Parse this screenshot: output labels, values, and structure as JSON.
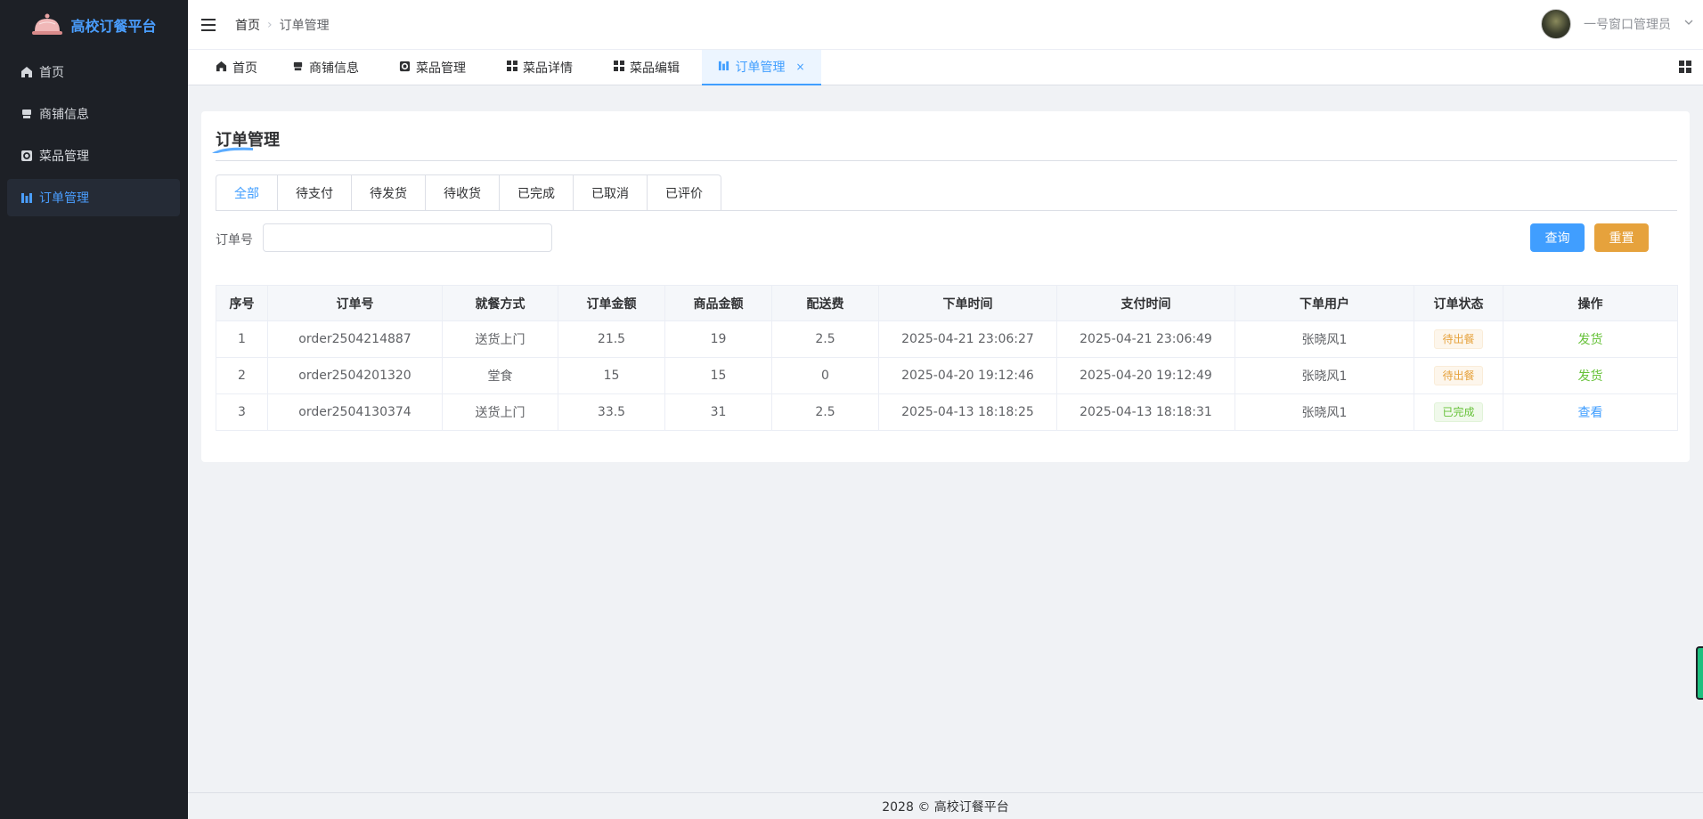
{
  "app": {
    "title": "高校订餐平台"
  },
  "sidebar": {
    "items": [
      {
        "label": "首页",
        "icon": "home-icon"
      },
      {
        "label": "商铺信息",
        "icon": "shop-icon"
      },
      {
        "label": "菜品管理",
        "icon": "dish-icon"
      },
      {
        "label": "订单管理",
        "icon": "orders-icon",
        "active": true
      }
    ]
  },
  "header": {
    "breadcrumb": [
      "首页",
      "订单管理"
    ],
    "user_name": "一号窗口管理员"
  },
  "tabs": [
    {
      "label": "首页",
      "icon": "home-icon"
    },
    {
      "label": "商铺信息",
      "icon": "shop-icon"
    },
    {
      "label": "菜品管理",
      "icon": "dish-icon"
    },
    {
      "label": "菜品详情",
      "icon": "grid-icon"
    },
    {
      "label": "菜品编辑",
      "icon": "grid-icon"
    },
    {
      "label": "订单管理",
      "icon": "orders-icon",
      "active": true,
      "close": "×"
    }
  ],
  "main": {
    "title": "订单管理",
    "status_tabs": [
      "全部",
      "待支付",
      "待发货",
      "待收货",
      "已完成",
      "已取消",
      "已评价"
    ],
    "active_status": "全部",
    "search": {
      "label": "订单号",
      "value": "",
      "placeholder": ""
    },
    "buttons": {
      "query": "查询",
      "reset": "重置"
    },
    "table": {
      "headers": [
        "序号",
        "订单号",
        "就餐方式",
        "订单金额",
        "商品金额",
        "配送费",
        "下单时间",
        "支付时间",
        "下单用户",
        "订单状态",
        "操作"
      ],
      "rows": [
        {
          "index": "1",
          "order_no": "order2504214887",
          "dining": "送货上门",
          "order_amount": "21.5",
          "goods_amount": "19",
          "delivery_fee": "2.5",
          "order_time": "2025-04-21 23:06:27",
          "pay_time": "2025-04-21 23:06:49",
          "user": "张晓风1",
          "status": "待出餐",
          "status_type": "warning",
          "action": "发货"
        },
        {
          "index": "2",
          "order_no": "order2504201320",
          "dining": "堂食",
          "order_amount": "15",
          "goods_amount": "15",
          "delivery_fee": "0",
          "order_time": "2025-04-20 19:12:46",
          "pay_time": "2025-04-20 19:12:49",
          "user": "张晓风1",
          "status": "待出餐",
          "status_type": "warning",
          "action": "发货"
        },
        {
          "index": "3",
          "order_no": "order2504130374",
          "dining": "送货上门",
          "order_amount": "33.5",
          "goods_amount": "31",
          "delivery_fee": "2.5",
          "order_time": "2025-04-13 18:18:25",
          "pay_time": "2025-04-13 18:18:31",
          "user": "张晓风1",
          "status": "已完成",
          "status_type": "success",
          "action": "查看"
        }
      ]
    }
  },
  "footer": {
    "text": "2028 © 高校订餐平台"
  },
  "colors": {
    "primary": "#409eff",
    "warning": "#e6a23c",
    "success": "#67c23a",
    "sidebar_bg": "#1d2026",
    "brand": "#4a9eff"
  }
}
